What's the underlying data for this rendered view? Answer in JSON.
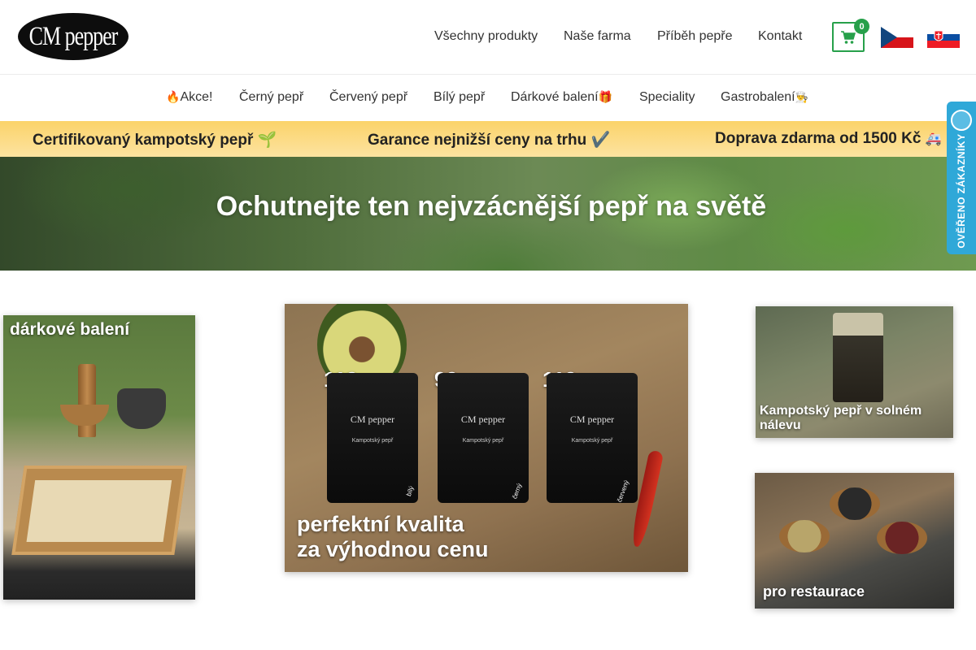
{
  "header": {
    "logo_text": "CM pepper",
    "nav": [
      "Všechny produkty",
      "Naše farma",
      "Příběh pepře",
      "Kontakt"
    ],
    "cart_count": "0",
    "languages": [
      "cs",
      "sk"
    ]
  },
  "categories": [
    {
      "icon": "🔥",
      "label": "Akce!"
    },
    {
      "icon": "",
      "label": "Černý pepř"
    },
    {
      "icon": "",
      "label": "Červený pepř"
    },
    {
      "icon": "",
      "label": "Bílý pepř"
    },
    {
      "icon": "🎁",
      "label": "Dárkové balení"
    },
    {
      "icon": "",
      "label": "Speciality"
    },
    {
      "icon": "👨‍🍳",
      "label": "Gastrobalení"
    }
  ],
  "benefits": [
    {
      "text": "Certifikovaný kampotský pepř",
      "icon": "🌱"
    },
    {
      "text": "Garance nejnižší ceny na trhu",
      "icon": "✔️"
    },
    {
      "text": "Doprava zdarma od 1500 Kč",
      "icon": "🚑"
    }
  ],
  "hero": {
    "title": "Ochutnejte ten nejvzácnější pepř na světě"
  },
  "verified_badge": {
    "text": "OVĚŘENO ZÁKAZNÍKY"
  },
  "banners": {
    "gift": {
      "title": "dárkové balení"
    },
    "main": {
      "prices": [
        "119,-",
        "99,-",
        "119,-"
      ],
      "bag_brand": "CM pepper",
      "bag_product": "Kampotský pepř",
      "bag_variants": [
        "bílý",
        "černý",
        "červený"
      ],
      "caption_line1": "perfektní kvalita",
      "caption_line2": "za výhodnou cenu"
    },
    "brine": {
      "title": "Kampotský pepř v solném nálevu"
    },
    "resto": {
      "title": "pro restaurace"
    }
  },
  "colors": {
    "accent_green": "#27a04a",
    "benefit_bar": "#fbd36a",
    "badge_blue": "#2fa8d8"
  }
}
